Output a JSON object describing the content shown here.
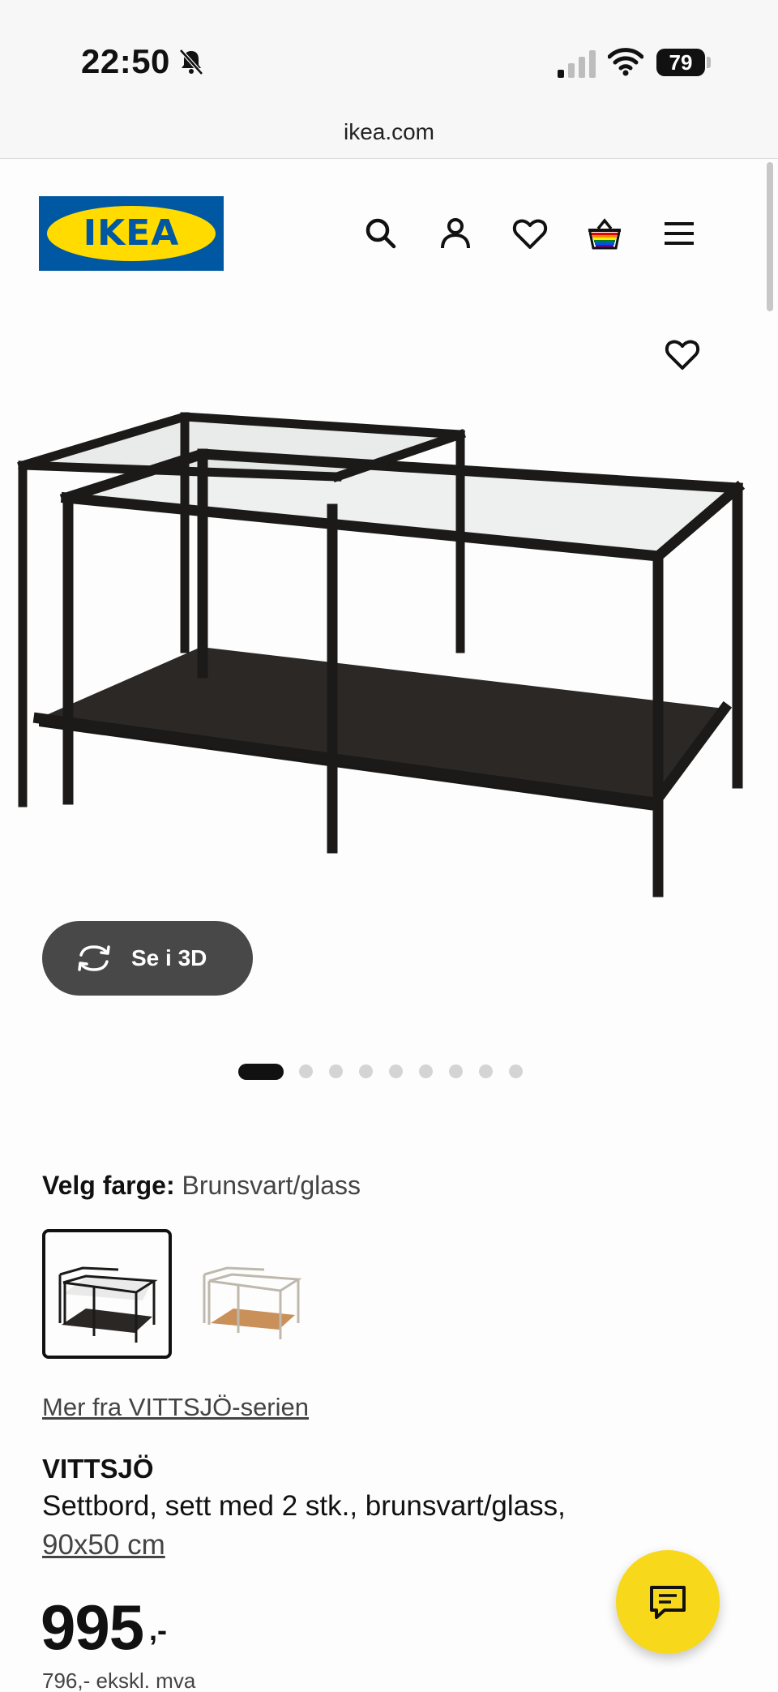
{
  "status_bar": {
    "time": "22:50",
    "battery": "79"
  },
  "browser": {
    "url": "ikea.com"
  },
  "header": {
    "logo_text": "IKEA",
    "icons": [
      "search-icon",
      "profile-icon",
      "heart-icon",
      "basket-icon",
      "menu-icon"
    ]
  },
  "gallery": {
    "view_3d_label": "Se i 3D",
    "dot_count": 9,
    "active_dot": 1
  },
  "color": {
    "label": "Velg farge:",
    "value": "Brunsvart/glass",
    "swatches": [
      "Brunsvart/glass",
      "Hvit/glass"
    ]
  },
  "product": {
    "series_link": "Mer fra VITTSJÖ-serien",
    "name": "VITTSJÖ",
    "description": "Settbord, sett med 2 stk., brunsvart/glass,",
    "size": "90x50 cm",
    "price": "995",
    "price_suffix": ",-",
    "price_ex_vat": "796,- ekskl. mva"
  },
  "colors": {
    "ikea_blue": "#0058a3",
    "ikea_yellow": "#ffdb00",
    "chat_yellow": "#f8d81b"
  }
}
